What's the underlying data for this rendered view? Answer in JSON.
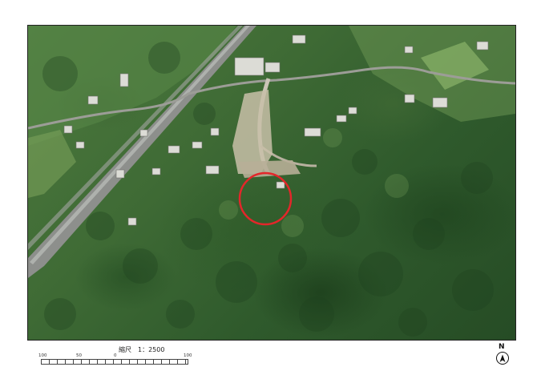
{
  "scale": {
    "caption": "縮尺　1：2500",
    "tick_labels": [
      "100",
      "50",
      "0",
      "100"
    ]
  },
  "north_arrow": {
    "label": "N"
  },
  "colors": {
    "marker_circle": "#e3262a",
    "forest": "#2f5a2c",
    "road": "#8d8f8c",
    "building": "#dcdcd6"
  },
  "icons": [
    "north-arrow-icon",
    "target-circle-icon"
  ]
}
